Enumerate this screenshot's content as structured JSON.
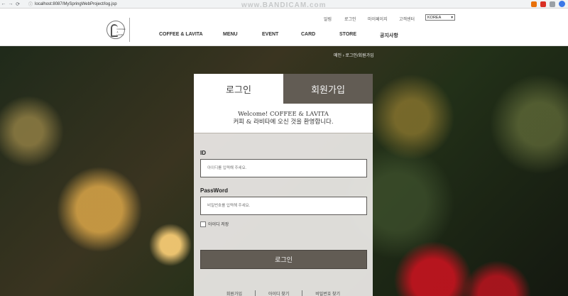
{
  "browser": {
    "back_icon": "←",
    "forward_icon": "→",
    "reload_icon": "⟳",
    "lock_icon": "ⓘ",
    "url": "localhost:8087/MySpringWebProject/log.jsp",
    "watermark": "www.BANDICAM.com"
  },
  "header": {
    "logo_text": "COFFEE & LAVITA",
    "util_menu": [
      "알림",
      "로그인",
      "마이페이지",
      "고객센터"
    ],
    "language": "KOREA",
    "nav": [
      "COFFEE & LAVITA",
      "MENU",
      "EVENT",
      "CARD",
      "STORE",
      "공지사항"
    ]
  },
  "breadcrumb": "메인 › 로그인/회원가입",
  "login": {
    "tab_login": "로그인",
    "tab_join": "회원가입",
    "welcome_line1": "Welcome! COFFEE & LAVITA",
    "welcome_line2": "커피 & 라비타에 오신 것을 환영합니다.",
    "id_label": "ID",
    "id_placeholder": "아이디를 입력해 주세요.",
    "pw_label": "PassWord",
    "pw_placeholder": "비밀번호를 입력해 주세요.",
    "remember_label": "아이디 저장",
    "submit_label": "로그인",
    "links": [
      "회원가입",
      "아이디 찾기",
      "비밀번호 찾기"
    ]
  },
  "colors": {
    "accent": "#625c54",
    "card_bg": "#eceae7"
  }
}
